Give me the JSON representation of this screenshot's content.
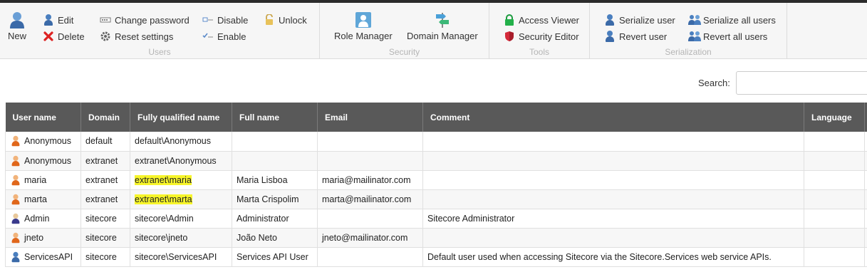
{
  "ribbon": {
    "users": {
      "label": "Users",
      "new": "New",
      "edit": "Edit",
      "delete": "Delete",
      "change_password": "Change password",
      "reset_settings": "Reset settings",
      "disable": "Disable",
      "enable": "Enable",
      "unlock": "Unlock"
    },
    "security": {
      "label": "Security",
      "role_manager": "Role Manager",
      "domain_manager": "Domain Manager"
    },
    "tools": {
      "label": "Tools",
      "access_viewer": "Access Viewer",
      "security_editor": "Security Editor"
    },
    "serialization": {
      "label": "Serialization",
      "serialize_user": "Serialize user",
      "revert_user": "Revert user",
      "serialize_all": "Serialize all users",
      "revert_all": "Revert all users"
    }
  },
  "search": {
    "label": "Search:",
    "value": ""
  },
  "table": {
    "headers": [
      "User name",
      "Domain",
      "Fully qualified name",
      "Full name",
      "Email",
      "Comment",
      "Language"
    ],
    "rows": [
      {
        "icon": "user-orange-icon",
        "user": "Anonymous",
        "domain": "default",
        "fqn": "default\\Anonymous",
        "fqn_highlight": false,
        "fullname": "",
        "email": "",
        "comment": "",
        "language": ""
      },
      {
        "icon": "user-orange-icon",
        "user": "Anonymous",
        "domain": "extranet",
        "fqn": "extranet\\Anonymous",
        "fqn_highlight": false,
        "fullname": "",
        "email": "",
        "comment": "",
        "language": ""
      },
      {
        "icon": "user-orange-icon",
        "user": "maria",
        "domain": "extranet",
        "fqn": "extranet\\maria",
        "fqn_highlight": true,
        "fullname": "Maria Lisboa",
        "email": "maria@mailinator.com",
        "comment": "",
        "language": ""
      },
      {
        "icon": "user-orange-icon",
        "user": "marta",
        "domain": "extranet",
        "fqn": "extranet\\marta",
        "fqn_highlight": true,
        "fullname": "Marta Crispolim",
        "email": "marta@mailinator.com",
        "comment": "",
        "language": ""
      },
      {
        "icon": "admin-icon",
        "user": "Admin",
        "domain": "sitecore",
        "fqn": "sitecore\\Admin",
        "fqn_highlight": false,
        "fullname": "Administrator",
        "email": "",
        "comment": "Sitecore Administrator",
        "language": ""
      },
      {
        "icon": "user-orange-icon",
        "user": "jneto",
        "domain": "sitecore",
        "fqn": "sitecore\\jneto",
        "fqn_highlight": false,
        "fullname": "João Neto",
        "email": "jneto@mailinator.com",
        "comment": "",
        "language": ""
      },
      {
        "icon": "user-blue-icon",
        "user": "ServicesAPI",
        "domain": "sitecore",
        "fqn": "sitecore\\ServicesAPI",
        "fqn_highlight": false,
        "fullname": "Services API User",
        "email": "",
        "comment": "Default user used when accessing Sitecore via the Sitecore.Services web service APIs.",
        "language": ""
      }
    ]
  },
  "colors": {
    "header_bg": "#595959",
    "highlight": "#f7f52a",
    "ribbon_bg": "#f6f6f6"
  }
}
